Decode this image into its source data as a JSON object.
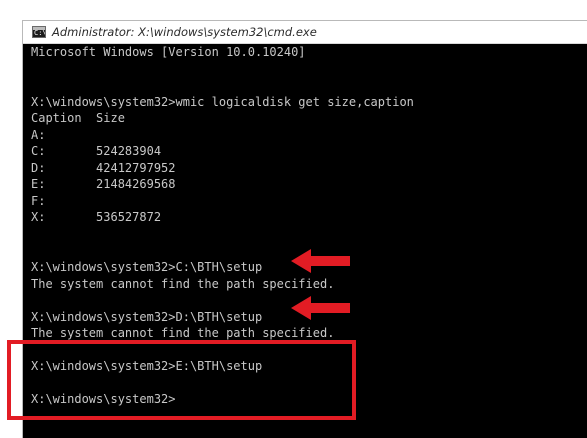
{
  "window": {
    "title": "Administrator: X:\\windows\\system32\\cmd.exe",
    "icon": "cmd-icon",
    "icon_glyph": "C:\\"
  },
  "console": {
    "lines": [
      "Microsoft Windows [Version 10.0.10240]",
      "",
      "",
      "X:\\windows\\system32>wmic logicaldisk get size,caption",
      "Caption  Size",
      "A:",
      "C:       524283904",
      "D:       42412797952",
      "E:       21484269568",
      "F:",
      "X:       536527872",
      "",
      "",
      "X:\\windows\\system32>C:\\BTH\\setup",
      "The system cannot find the path specified.",
      "",
      "X:\\windows\\system32>D:\\BTH\\setup",
      "The system cannot find the path specified.",
      "",
      "X:\\windows\\system32>E:\\BTH\\setup",
      "",
      "X:\\windows\\system32>"
    ]
  },
  "colors": {
    "console_background": "#000000",
    "console_text": "#c8c8c8",
    "annotation": "#e21c24"
  },
  "annotations": {
    "arrows": [
      "red-arrow-icon",
      "red-arrow-icon"
    ],
    "highlight_box": "red-highlight-box"
  }
}
